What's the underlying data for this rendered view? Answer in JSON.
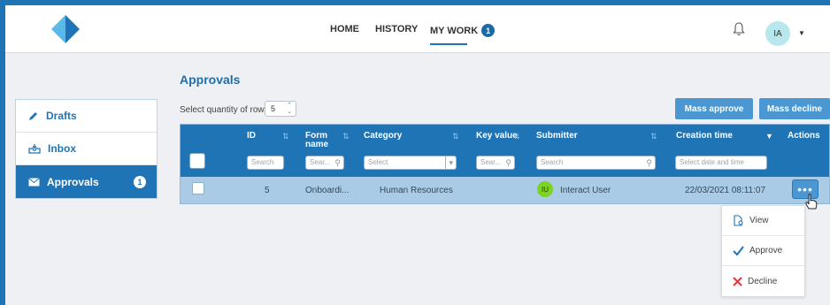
{
  "nav": {
    "home": "HOME",
    "history": "HISTORY",
    "mywork": "MY WORK",
    "mywork_badge": "1"
  },
  "user": {
    "initials": "IA"
  },
  "sidebar": {
    "items": [
      {
        "label": "Drafts",
        "icon": "pencil-icon"
      },
      {
        "label": "Inbox",
        "icon": "inbox-icon"
      },
      {
        "label": "Approvals",
        "icon": "envelope-icon",
        "badge": "1"
      }
    ]
  },
  "page": {
    "title": "Approvals",
    "rows_label": "Select quantity of rows:",
    "rows_value": "5"
  },
  "buttons": {
    "mass_approve": "Mass approve",
    "mass_decline": "Mass decline"
  },
  "table": {
    "headers": {
      "id": "ID",
      "form_name": "Form name",
      "category": "Category",
      "key_value": "Key value",
      "submitter": "Submitter",
      "creation_time": "Creation time",
      "actions": "Actions"
    },
    "filters": {
      "id": "Search",
      "form_name": "Sear...",
      "category": "Select",
      "key_value": "Sear...",
      "submitter": "Search",
      "creation_time": "Select date and time"
    },
    "rows": [
      {
        "id": "5",
        "form_name": "Onboardi...",
        "category": "Human Resources",
        "submitter_initials": "IU",
        "submitter": "Interact User",
        "creation_time": "22/03/2021 08:11:07",
        "actions": "•••"
      }
    ]
  },
  "menu": {
    "view": "View",
    "approve": "Approve",
    "decline": "Decline"
  },
  "colors": {
    "primary": "#1f74b5",
    "row_selected": "#a9cbe6",
    "button": "#4a97d2",
    "approve_check": "#1f74b5",
    "decline_x": "#e0393e"
  }
}
